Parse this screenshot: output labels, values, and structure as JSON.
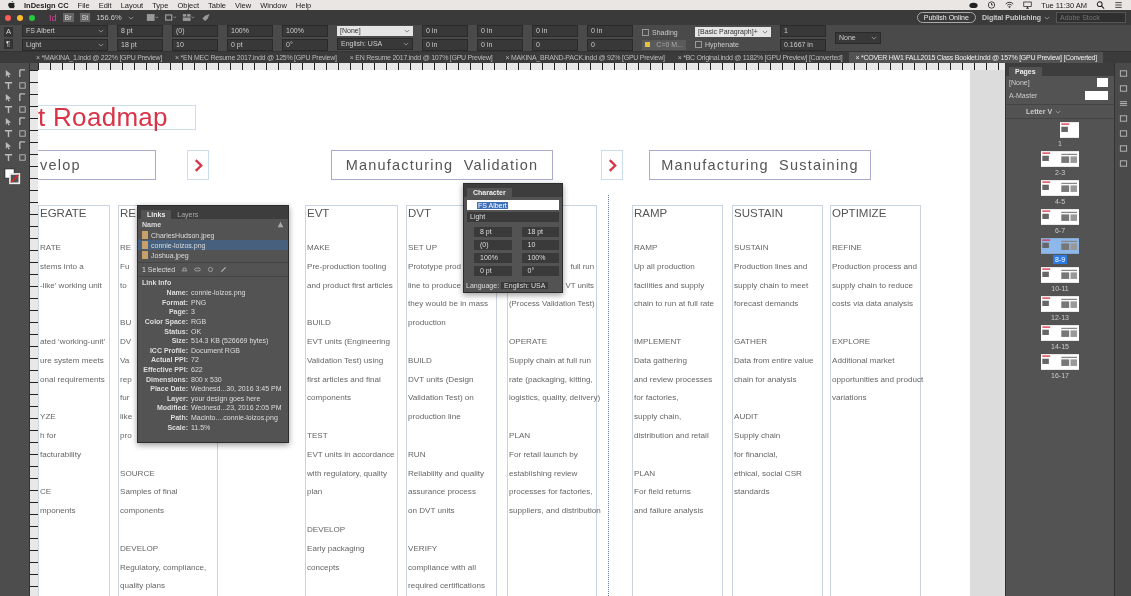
{
  "menubar": {
    "menus": [
      "InDesign CC",
      "File",
      "Edit",
      "Layout",
      "Type",
      "Object",
      "Table",
      "View",
      "Window",
      "Help"
    ],
    "clock": "Tue 11:30 AM"
  },
  "app_bar": {
    "logo": "Id",
    "apps": [
      "Br",
      "St"
    ],
    "zoom": "156.6%",
    "publish_button": "Publish Online",
    "workspace": "Digital Publishing",
    "search": {
      "placeholder": "Adobe Stock"
    }
  },
  "control_panel": {
    "modes": [
      "A",
      "¶"
    ],
    "groups": [
      {
        "items": [
          {
            "kind": "font_select",
            "value": "FS Albert"
          },
          {
            "kind": "font_select",
            "value": "Light"
          }
        ]
      },
      {
        "items": [
          {
            "kind": "spin",
            "value": "8 pt"
          },
          {
            "kind": "spin",
            "value": "18 pt"
          }
        ]
      },
      {
        "items": [
          {
            "kind": "spin",
            "value": "(0)"
          },
          {
            "kind": "spin",
            "value": "10"
          }
        ]
      },
      {
        "items": [
          {
            "kind": "spin",
            "value": "100%"
          },
          {
            "kind": "spin",
            "value": "0 pt"
          }
        ]
      },
      {
        "items": [
          {
            "kind": "spin",
            "value": "100%"
          },
          {
            "kind": "spin",
            "value": "0°"
          }
        ]
      },
      {
        "items": [
          {
            "kind": "light_select",
            "value": "[None]"
          },
          {
            "kind": "select",
            "value": "English: USA"
          }
        ]
      },
      {
        "items": [
          {
            "kind": "spin",
            "value": "0 in"
          },
          {
            "kind": "spin",
            "value": "0 in"
          }
        ]
      },
      {
        "items": [
          {
            "kind": "spin",
            "value": "0 in"
          },
          {
            "kind": "spin",
            "value": "0 in"
          }
        ]
      },
      {
        "items": [
          {
            "kind": "spin",
            "value": "0 in"
          },
          {
            "kind": "spin",
            "value": "0"
          }
        ]
      },
      {
        "items": [
          {
            "kind": "spin",
            "value": "0 in"
          },
          {
            "kind": "spin",
            "value": "0"
          }
        ]
      },
      {
        "items": [
          {
            "kind": "checkbox",
            "value": "Shading",
            "checked": false
          },
          {
            "kind": "swatch",
            "value": "C=0 M..."
          }
        ]
      },
      {
        "items": [
          {
            "kind": "light_select",
            "value": "[Basic Paragraph]+"
          },
          {
            "kind": "checkbox",
            "value": "Hyphenate",
            "checked": false
          }
        ]
      },
      {
        "items": [
          {
            "kind": "spin",
            "value": "1"
          },
          {
            "kind": "spin",
            "value": "0.1667 in"
          }
        ]
      },
      {
        "items": [
          {
            "kind": "select",
            "value": "None"
          }
        ]
      }
    ]
  },
  "tabs": [
    {
      "label": "*MAKINA_1.indd @ 222% [GPU Preview]",
      "selected": false
    },
    {
      "label": "*EN MEC Resume 2017.indd @ 125% [GPU Preview]",
      "selected": false
    },
    {
      "label": "EN Resume 2017.indd @ 107% [GPU Preview]",
      "selected": false
    },
    {
      "label": "MAKINA_BRAND-PACK.indd @ 92% [GPU Preview]",
      "selected": false
    },
    {
      "label": "*BC Original.indd @ 1182% [GPU Preview] [Converted]",
      "selected": false
    },
    {
      "label": "*COVER HW1 FALL2015 Class Booklet.indd @ 157% [GPU Preview] [Converted]",
      "selected": true
    }
  ],
  "tab_close": "×",
  "document": {
    "title": "t Roadmap",
    "phases": [
      {
        "kind": "phase",
        "label": "velop"
      },
      {
        "kind": "arrow"
      },
      {
        "kind": "phase",
        "label": "Manufacturing  Validation"
      },
      {
        "kind": "arrow"
      },
      {
        "kind": "phase",
        "label": "Manufacturing  Sustaining"
      }
    ],
    "columns": [
      {
        "heading": "EGRATE",
        "sections": [
          {
            "label": "RATE",
            "lines": [
              "stems into a",
              "-like’ working unit"
            ]
          },
          {
            "lines": [
              "ated ‘working-unit’",
              "ure system meets",
              "onal requirements"
            ]
          },
          {
            "label": "YZE",
            "lines": [
              "h for",
              "facturability"
            ]
          },
          {
            "label": "CE",
            "lines": [
              "mponents"
            ]
          }
        ]
      },
      {
        "heading": "RE",
        "sections": [
          {
            "label": "RE",
            "lines": [
              "Fu",
              "to"
            ]
          },
          {
            "label": "BU",
            "lines": [
              "DV",
              "Va",
              "rep",
              "fur",
              "like",
              "pro"
            ]
          },
          {
            "label": "SOURCE",
            "lines": [
              "Samples of final",
              "components"
            ]
          },
          {
            "label": "DEVELOP",
            "lines": [
              "Regulatory, compliance,",
              "quality plans"
            ]
          }
        ]
      },
      {
        "heading": "EVT",
        "sections": [
          {
            "label": "MAKE",
            "lines": [
              "Pre-production tooling",
              "and product first articles"
            ]
          },
          {
            "label": "BUILD",
            "lines": [
              "EVT units (Engineering",
              "Validation Test) using",
              "first articles and final",
              "components"
            ]
          },
          {
            "label": "TEST",
            "lines": [
              "EVT units in accordance",
              "with regulatory, quality",
              "plan"
            ]
          },
          {
            "label": "DEVELOP",
            "lines": [
              "Early packaging",
              "concepts"
            ]
          }
        ]
      },
      {
        "heading": "DVT",
        "sections": [
          {
            "label": "SET UP",
            "lines": [
              "Prototype prod",
              "line to produce",
              "they would be in mass",
              "production"
            ]
          },
          {
            "label": "BUILD",
            "lines": [
              "DVT units (Design",
              "Validation Test) on",
              "production line"
            ]
          },
          {
            "label": "RUN",
            "lines": [
              "Reliability and quality",
              "assurance process",
              "on DVT units"
            ]
          },
          {
            "label": "VERIFY",
            "lines": [
              "compliance with all",
              "required certifications"
            ]
          }
        ]
      },
      {
        "sections": [
          {
            "covered": true,
            "lines": [
              "full run",
              "VT units",
              "(Process Validation Test)"
            ]
          },
          {
            "covered": false,
            "label": "OPERATE",
            "lines": [
              "Supply chain at full run",
              "rate (packaging, kitting,",
              "logistics, quality, delivery)"
            ]
          },
          {
            "covered": false,
            "label": "PLAN",
            "lines": [
              "For retail launch by",
              "establishing review",
              "processes for factories,",
              "suppliers, and distribution"
            ]
          }
        ]
      },
      {
        "heading": "RAMP",
        "sections": [
          {
            "label": "RAMP",
            "lines": [
              "Up all production",
              "facilities and supply",
              "chain to run at full rate"
            ]
          },
          {
            "label": "IMPLEMENT",
            "lines": [
              "Data gathering",
              "and review processes",
              "for factories,",
              "supply chain,",
              "distribution and retail"
            ]
          },
          {
            "label": "PLAN",
            "lines": [
              "For field returns",
              "and failure analysis"
            ]
          }
        ]
      },
      {
        "heading": "SUSTAIN",
        "sections": [
          {
            "label": "SUSTAIN",
            "lines": [
              "Production lines and",
              "supply chain to meet",
              "forecast demands"
            ]
          },
          {
            "label": "GATHER",
            "lines": [
              "Data from entire value",
              "chain for analysis"
            ]
          },
          {
            "label": "AUDIT",
            "lines": [
              "Supply chain",
              "for financial,",
              "ethical, social CSR",
              "standards"
            ]
          }
        ]
      },
      {
        "heading": "OPTIMIZE",
        "sections": [
          {
            "label": "REFINE",
            "lines": [
              "Production process and",
              "supply chain to reduce",
              "costs via data analysis"
            ]
          },
          {
            "label": "EXPLORE",
            "lines": [
              "Additional market",
              "opportunities and product",
              "variations"
            ]
          }
        ]
      }
    ]
  },
  "links_panel": {
    "tabs": [
      {
        "label": "Links",
        "selected": true
      },
      {
        "label": "Layers",
        "selected": false
      }
    ],
    "column_header": "Name",
    "links": [
      {
        "name": "CharlesHudson.jpeg",
        "selected": false
      },
      {
        "name": "connie-loizos.png",
        "selected": true
      },
      {
        "name": "Joshua.jpeg",
        "selected": false
      }
    ],
    "selection_count": "1 Selected",
    "info_title": "Link Info",
    "info": [
      {
        "label": "Name:",
        "value": "connie-loizos.png"
      },
      {
        "label": "Format:",
        "value": "PNG"
      },
      {
        "label": "Page:",
        "value": "3"
      },
      {
        "label": "Color Space:",
        "value": "RGB"
      },
      {
        "label": "Status:",
        "value": "OK"
      },
      {
        "label": "Size:",
        "value": "514.3 KB (526669 bytes)"
      },
      {
        "label": "ICC Profile:",
        "value": "Document RGB"
      },
      {
        "label": "Actual PPI:",
        "value": "72"
      },
      {
        "label": "Effective PPI:",
        "value": "622"
      },
      {
        "label": "Dimensions:",
        "value": "800 x 530"
      },
      {
        "label": "Place Date:",
        "value": "Wednesd...30, 2016 3:45 PM"
      },
      {
        "label": "Layer:",
        "value": "your design goes here"
      },
      {
        "label": "Modified:",
        "value": "Wednesd...23, 2016 2:05 PM"
      },
      {
        "label": "Path:",
        "value": "Macinto....connie-loizos.png"
      },
      {
        "label": "Scale:",
        "value": "11.5%"
      }
    ]
  },
  "character_panel": {
    "title": "Character",
    "font": "FS Albert",
    "style": "Light",
    "fields": [
      "8 pt",
      "18 pt",
      "(0)",
      "10",
      "100%",
      "100%",
      "0 pt",
      "0°"
    ],
    "language_label": "Language:",
    "language": "English: USA"
  },
  "pages_panel": {
    "title": "Pages",
    "masters": [
      {
        "label": "[None]",
        "kind": "single"
      },
      {
        "label": "A-Master",
        "kind": "spread"
      }
    ],
    "page_size": "Letter V",
    "pages": [
      {
        "label": "1",
        "kind": "single",
        "selected": false
      },
      {
        "label": "2-3",
        "kind": "spread",
        "selected": false
      },
      {
        "label": "4-5",
        "kind": "spread",
        "selected": false
      },
      {
        "label": "6-7",
        "kind": "spread",
        "selected": false
      },
      {
        "label": "8-9",
        "kind": "spread",
        "selected": true
      },
      {
        "label": "10-11",
        "kind": "spread",
        "selected": false
      },
      {
        "label": "12-13",
        "kind": "spread",
        "selected": false
      },
      {
        "label": "14-15",
        "kind": "spread",
        "selected": false
      },
      {
        "label": "16-17",
        "kind": "spread",
        "selected": false
      }
    ]
  }
}
